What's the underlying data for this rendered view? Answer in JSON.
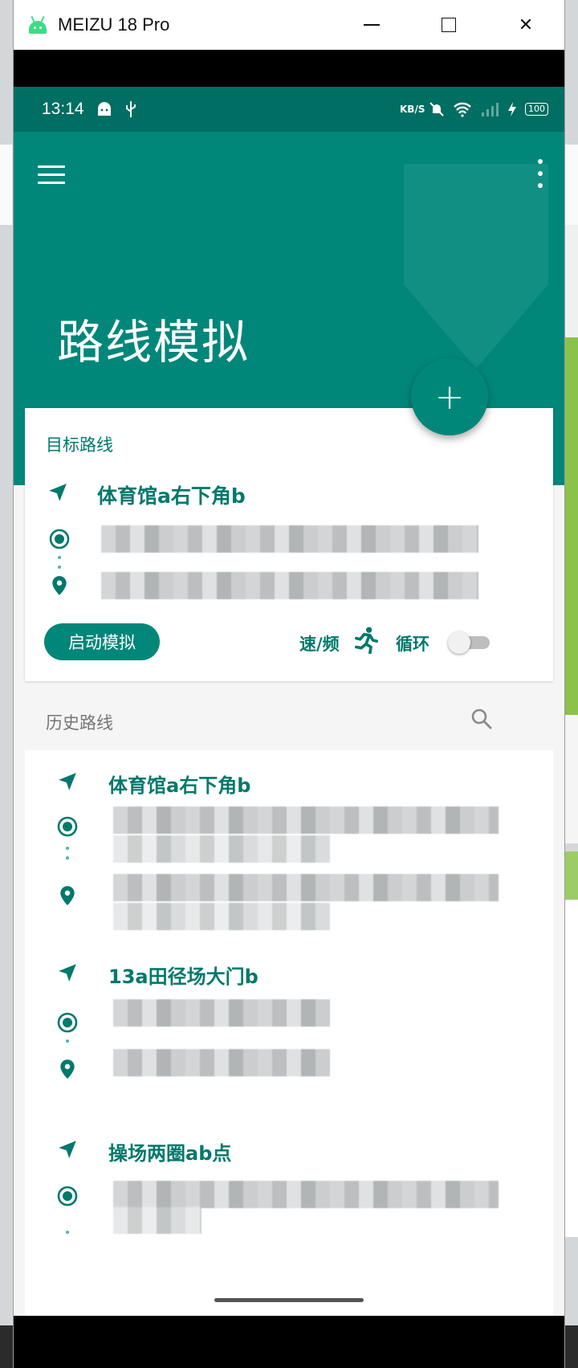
{
  "window": {
    "title": "MEIZU 18 Pro",
    "minimize_icon": "minimize-icon",
    "maximize_icon": "maximize-icon",
    "close_symbol": "✕"
  },
  "status_bar": {
    "time": "13:14",
    "network_speed": "KB/S",
    "battery": "100"
  },
  "app_bar": {
    "title": "路线模拟",
    "menu_icon": "hamburger-menu-icon",
    "more_icon": "more-vertical-icon",
    "accent_color": "#00877a"
  },
  "fab": {
    "symbol": "+"
  },
  "target_route": {
    "section_label": "目标路线",
    "route_name": "体育馆a右下角b",
    "start_button": "启动模拟",
    "speed_label": "速/频",
    "loop_label": "循环",
    "loop_enabled": false
  },
  "history": {
    "section_label": "历史路线",
    "items": [
      {
        "name": "体育馆a右下角b"
      },
      {
        "name": "13a田径场大门b"
      },
      {
        "name": "操场两圈ab点"
      }
    ]
  }
}
